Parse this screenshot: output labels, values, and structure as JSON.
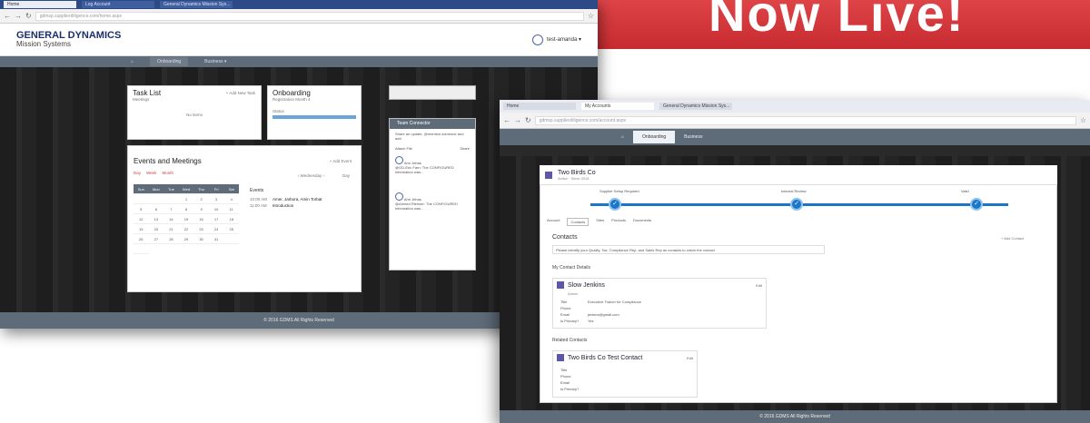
{
  "banner": {
    "text": "Now Live!"
  },
  "window1": {
    "tabs": [
      "Home",
      "Log Account",
      "General Dynamics Mission Sys..."
    ],
    "url": "gdmsp.supplierdiligence.com/home.aspx",
    "logo_line1": "GENERAL DYNAMICS",
    "logo_line2": "Mission Systems",
    "user_label": "test-amanda ▾",
    "nav": [
      "Onboarding",
      "Business ▾"
    ],
    "task_list": {
      "title": "Task List",
      "subtitle": "Meetings",
      "link": "+ Add New Task",
      "empty": "No items"
    },
    "onboarding": {
      "title": "Onboarding",
      "subtitle": "Registration Month 4",
      "progress_label": "Status"
    },
    "events": {
      "title": "Events and Meetings",
      "link": "+ Add Event",
      "filters": [
        "Day",
        "Week",
        "Month"
      ],
      "month": "‹ Wednesday ›",
      "view": "Day"
    },
    "calendar_header": [
      "Sun",
      "Mon",
      "Tue",
      "Wed",
      "Thu",
      "Fri",
      "Sat"
    ],
    "calendar_days": [
      "",
      "",
      "",
      "1",
      "2",
      "3",
      "4",
      "5",
      "6",
      "7",
      "8",
      "9",
      "10",
      "11",
      "12",
      "13",
      "14",
      "15",
      "16",
      "17",
      "18",
      "19",
      "20",
      "21",
      "22",
      "23",
      "24",
      "25",
      "26",
      "27",
      "28",
      "29",
      "30",
      "31",
      "",
      ""
    ],
    "agenda_title": "Events",
    "agenda": [
      {
        "time": "10:00 AM",
        "text": "Amer, Jarbora, Amin Torbat"
      },
      {
        "time": "11:00 AM",
        "text": "Introduction"
      }
    ],
    "chat": {
      "header": "Team Connector",
      "intro": "Share an update, @mention someone and add",
      "attach": "Attach File",
      "share": "Share",
      "messages": [
        {
          "name": "Ahn Jebas",
          "text": "@GD-Eric Farn: The CONFIGURED information was..."
        },
        {
          "name": "Ahn Jebas",
          "text": "@Ahmed Riehner: The CONFIGURED information was..."
        }
      ]
    },
    "footer": "© 2016 GDMS All Rights Reserved"
  },
  "window2": {
    "tabs": [
      "Home",
      "My Accounts",
      "General Dynamics Mission Sys..."
    ],
    "url": "gdmsp.supplierdiligence.com/account.aspx",
    "nav": [
      "Onboarding",
      "Business"
    ],
    "firm": {
      "name": "Two Birds Co",
      "sub": "Active · Since 2016"
    },
    "steps": [
      "Supplier Setup Required",
      "Internal Review",
      "Valid"
    ],
    "subtabs": [
      "Account",
      "Contacts",
      "Sites",
      "Products",
      "Documents"
    ],
    "contacts_title": "Contacts",
    "contacts_info": "Please identify your Quality, Tax, Compliance Rep, and Sales Rep as contacts to check the contact",
    "add_contact": "+ Add Contact",
    "my_contact_label": "My Contact Details",
    "my_contact": {
      "name": "Slow Jenkins",
      "sub": "Admin",
      "edit": "Edit",
      "rows": [
        [
          "Title",
          "Executive Trainer for Compliance"
        ],
        [
          "Phone",
          ""
        ],
        [
          "Email",
          "jenkins@gmail.com"
        ],
        [
          "Is Primary?",
          "Yes"
        ]
      ]
    },
    "related_label": "Related Contacts",
    "related": {
      "name": "Two Birds Co Test Contact",
      "edit": "Edit",
      "rows": [
        [
          "Title",
          ""
        ],
        [
          "Phone",
          ""
        ],
        [
          "Email",
          ""
        ],
        [
          "Is Primary?",
          ""
        ]
      ]
    },
    "footer": "© 2016 GDMS All Rights Reserved"
  }
}
